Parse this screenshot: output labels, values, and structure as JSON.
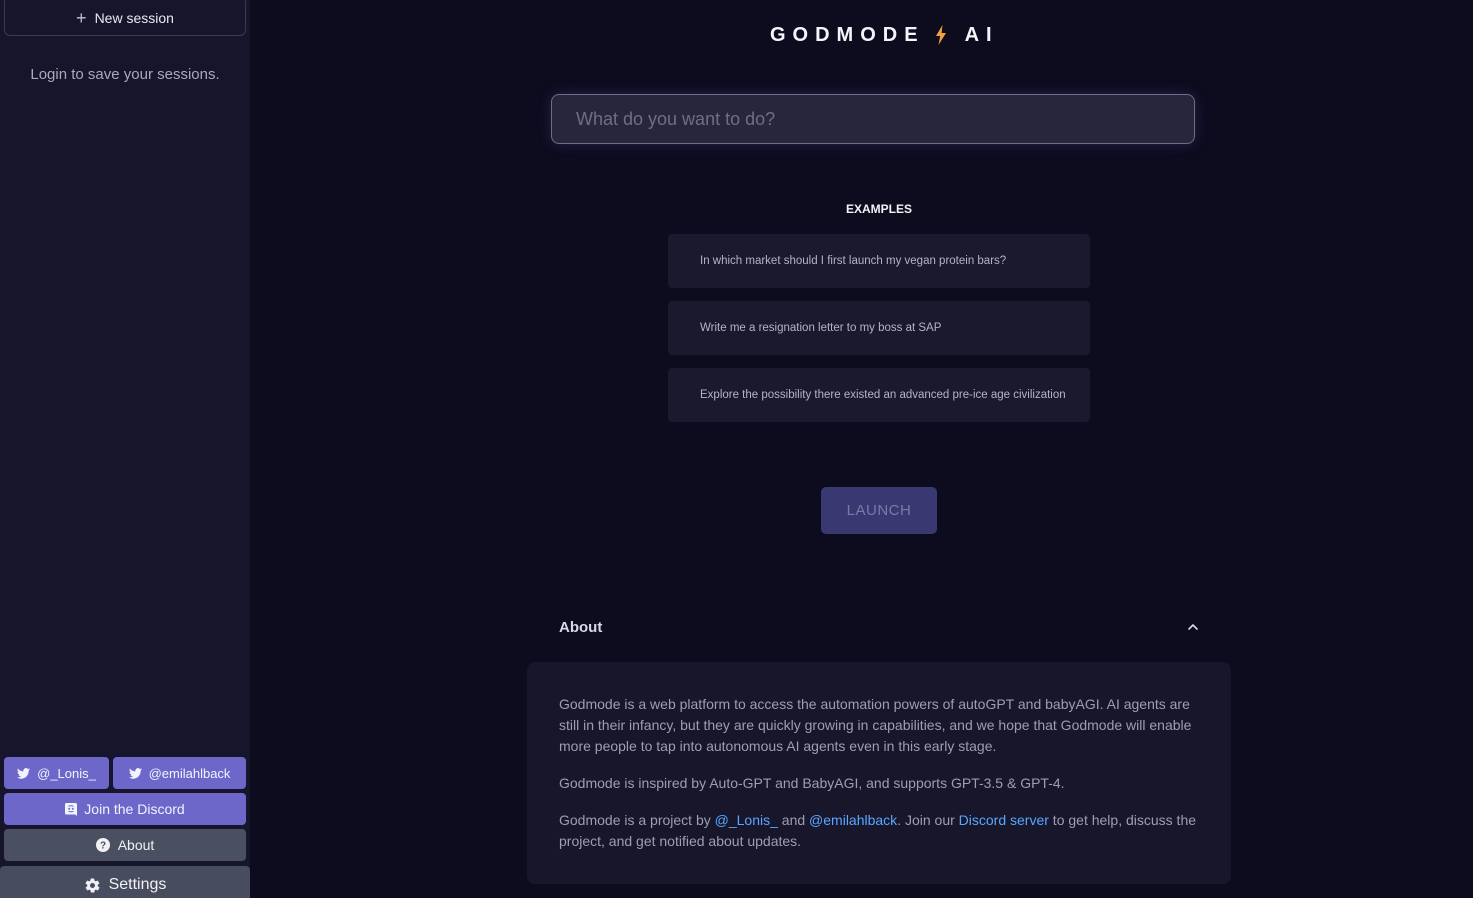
{
  "sidebar": {
    "new_session_label": "New session",
    "login_note": "Login to save your sessions.",
    "twitter1_label": "@_Lonis_",
    "twitter2_label": "@emilahlback",
    "discord_label": "Join the Discord",
    "about_label": "About",
    "settings_label": "Settings"
  },
  "header": {
    "brand_left": "GODMODE",
    "brand_right": "AI"
  },
  "search": {
    "placeholder": "What do you want to do?",
    "value": ""
  },
  "examples": {
    "title": "EXAMPLES",
    "items": [
      "In which market should I first launch my vegan protein bars?",
      "Write me a resignation letter to my boss at SAP",
      "Explore the possibility there existed an advanced pre-ice age civilization"
    ]
  },
  "launch_label": "LAUNCH",
  "about": {
    "title": "About",
    "p1": "Godmode is a web platform to access the automation powers of autoGPT and babyAGI. AI agents are still in their infancy, but they are quickly growing in capabilities, and we hope that Godmode will enable more people to tap into autonomous AI agents even in this early stage.",
    "p2": "Godmode is inspired by Auto-GPT and BabyAGI, and supports GPT-3.5 & GPT-4.",
    "p3_part1": "Godmode is a project by ",
    "p3_link1": "@_Lonis_",
    "p3_part2": " and ",
    "p3_link2": "@emilahlback",
    "p3_part3": ". Join our ",
    "p3_link3": "Discord server",
    "p3_part4": " to get help, discuss the project, and get notified about updates."
  },
  "colors": {
    "background": "#0d0b1e",
    "sidebar": "#16152b",
    "accent_purple": "#6c67c9",
    "bolt": "#f0a33a",
    "link": "#5aa7ff"
  },
  "icons": {
    "new_session": "plus-icon",
    "twitter": "twitter-icon",
    "discord": "discord-icon",
    "about": "question-circle-icon",
    "settings": "gear-icon",
    "brand": "lightning-bolt-icon",
    "collapse": "chevron-up-icon"
  }
}
